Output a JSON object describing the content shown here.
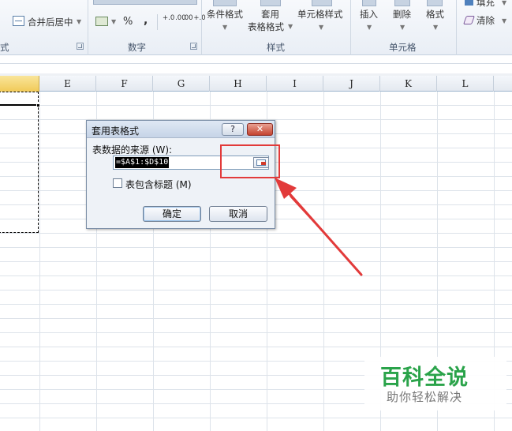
{
  "ribbon": {
    "merge_center": "合并后居中",
    "percent": "%",
    "comma": ",",
    "dec_increase": "+.0 .00",
    "dec_decrease": ".00 +.0",
    "conditional_format": "条件格式",
    "format_as_table_line1": "套用",
    "format_as_table_line2": "表格格式",
    "cell_styles": "单元格样式",
    "insert": "插入",
    "delete": "删除",
    "format": "格式",
    "fill": "填充",
    "clear": "清除",
    "group_alignment_partial": "式",
    "group_number": "数字",
    "group_styles": "样式",
    "group_cells": "单元格"
  },
  "columns": [
    "E",
    "F",
    "G",
    "H",
    "I",
    "J",
    "K",
    "L"
  ],
  "dialog": {
    "title": "套用表格式",
    "help": "?",
    "close": "✕",
    "source_label": "表数据的来源 (W):",
    "range_value": "=$A$1:$D$10",
    "header_checkbox_label": "表包含标题 (M)",
    "header_checked": false,
    "ok": "确定",
    "cancel": "取消"
  },
  "watermark": {
    "main": "百科全说",
    "sub": "助你轻松解决"
  },
  "colors": {
    "annotation": "#e23a3a",
    "selected_column_header": "#f1ca58",
    "watermark_green": "#2aa34a"
  }
}
